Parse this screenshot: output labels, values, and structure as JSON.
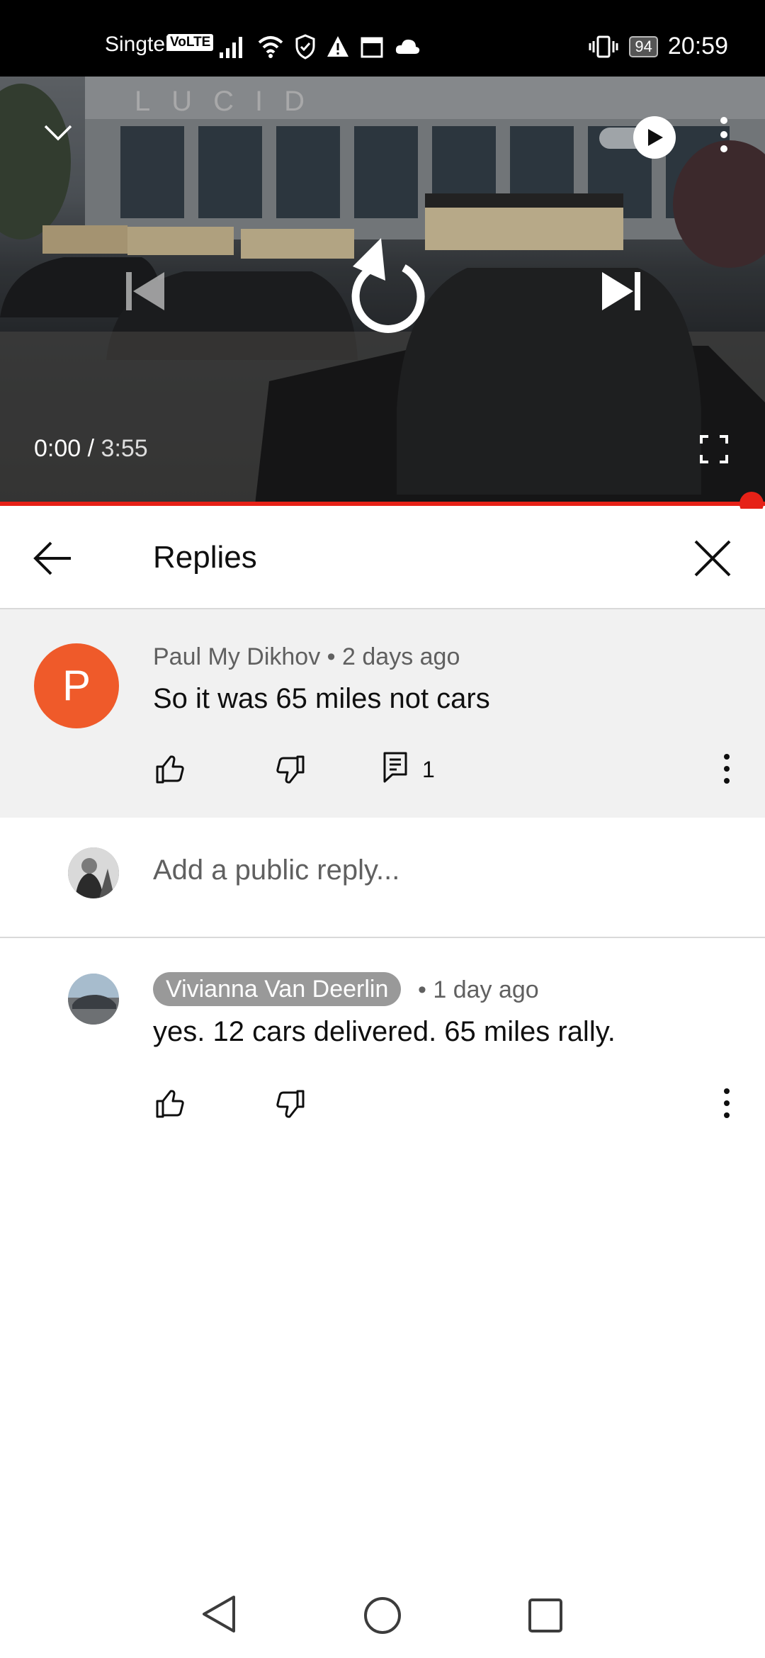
{
  "status_bar": {
    "carrier": "Singtel",
    "volte": "VoLTE",
    "battery": "94",
    "time": "20:59"
  },
  "player": {
    "current_time": "0:00",
    "separator": " / ",
    "duration": "3:55",
    "progress_fraction": 1.0,
    "accent_color": "#e62117"
  },
  "replies_header": {
    "title": "Replies"
  },
  "parent_comment": {
    "avatar_letter": "P",
    "avatar_color": "#ef5a2a",
    "author": "Paul My Dikhov",
    "time": "2 days ago",
    "text": "So it was 65 miles not cars",
    "reply_count": "1"
  },
  "add_reply": {
    "placeholder": "Add a public reply..."
  },
  "replies": [
    {
      "author": "Vivianna Van Deerlin",
      "time": "1 day ago",
      "text": "yes. 12 cars delivered. 65 miles rally."
    }
  ],
  "icons": {
    "collapse": "chevron-down-icon",
    "autoplay": "autoplay-toggle",
    "more": "more-vert-icon",
    "previous": "skip-previous-icon",
    "replay": "replay-icon",
    "next": "skip-next-icon",
    "fullscreen": "fullscreen-icon",
    "back": "arrow-back-icon",
    "close": "close-icon",
    "like": "thumb-up-icon",
    "dislike": "thumb-down-icon",
    "reply": "comment-icon"
  }
}
